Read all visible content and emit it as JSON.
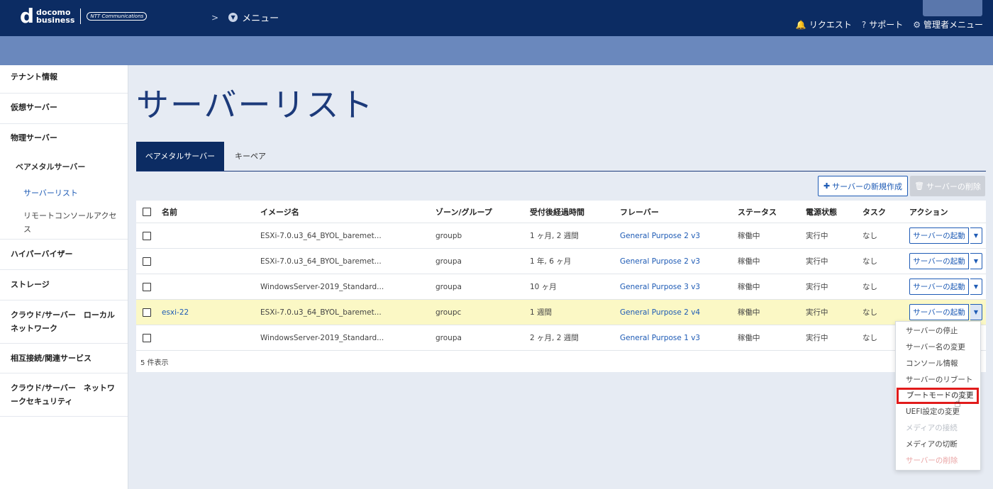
{
  "header": {
    "logo_d": "d",
    "logo_line1": "docomo",
    "logo_line2": "business",
    "logo_ntt": "NTT Communications",
    "breadcrumb_chevron": ">",
    "menu_label": "メニュー",
    "nav": [
      {
        "icon": "bell-icon",
        "label": "リクエスト"
      },
      {
        "icon": "help-icon",
        "label": "サポート"
      },
      {
        "icon": "gear-icon",
        "label": "管理者メニュー"
      }
    ]
  },
  "sidebar": {
    "items": [
      {
        "label": "テナント情報"
      },
      {
        "label": "仮想サーバー"
      },
      {
        "label": "物理サーバー"
      },
      {
        "label": "ベアメタルサーバー"
      },
      {
        "label": "サーバーリスト"
      },
      {
        "label": "リモートコンソールアクセス"
      },
      {
        "label": "ハイパーバイザー"
      },
      {
        "label": "ストレージ"
      },
      {
        "label": "クラウド/サーバー　ローカルネットワーク"
      },
      {
        "label": "相互接続/関連サービス"
      },
      {
        "label": "クラウド/サーバー　ネットワークセキュリティ"
      }
    ]
  },
  "main": {
    "title": "サーバーリスト",
    "tabs": [
      {
        "label": "ベアメタルサーバー",
        "active": true
      },
      {
        "label": "キーペア",
        "active": false
      }
    ],
    "create_button": "サーバーの新規作成",
    "delete_button": "サーバーの削除",
    "table": {
      "columns": [
        "名前",
        "イメージ名",
        "ゾーン/グループ",
        "受付後経過時間",
        "フレーバー",
        "ステータス",
        "電源状態",
        "タスク",
        "アクション"
      ],
      "rows": [
        {
          "name": "",
          "image": "ESXi-7.0.u3_64_BYOL_baremet...",
          "zone": "groupb",
          "elapsed": "1 ヶ月, 2 週間",
          "flavor": "General Purpose 2 v3",
          "status": "稼働中",
          "power": "実行中",
          "task": "なし",
          "action": "サーバーの起動"
        },
        {
          "name": "",
          "image": "ESXi-7.0.u3_64_BYOL_baremet...",
          "zone": "groupa",
          "elapsed": "1 年, 6 ヶ月",
          "flavor": "General Purpose 2 v3",
          "status": "稼働中",
          "power": "実行中",
          "task": "なし",
          "action": "サーバーの起動"
        },
        {
          "name": "",
          "image": "WindowsServer-2019_Standard...",
          "zone": "groupa",
          "elapsed": "10 ヶ月",
          "flavor": "General Purpose 3 v3",
          "status": "稼働中",
          "power": "実行中",
          "task": "なし",
          "action": "サーバーの起動"
        },
        {
          "name": "esxi-22",
          "image": "ESXi-7.0.u3_64_BYOL_baremet...",
          "zone": "groupc",
          "elapsed": "1 週間",
          "flavor": "General Purpose 2 v4",
          "status": "稼働中",
          "power": "実行中",
          "task": "なし",
          "action": "サーバーの起動"
        },
        {
          "name": "",
          "image": "WindowsServer-2019_Standard...",
          "zone": "groupa",
          "elapsed": "2 ヶ月, 2 週間",
          "flavor": "General Purpose 1 v3",
          "status": "稼働中",
          "power": "実行中",
          "task": "なし",
          "action": ""
        }
      ],
      "footer": "5 件表示"
    },
    "dropdown": [
      {
        "label": "サーバーの停止",
        "state": "enabled"
      },
      {
        "label": "サーバー名の変更",
        "state": "enabled"
      },
      {
        "label": "コンソール情報",
        "state": "enabled"
      },
      {
        "label": "サーバーのリブート",
        "state": "enabled"
      },
      {
        "label": "ブートモードの変更",
        "state": "highlighted"
      },
      {
        "label": "UEFI設定の変更",
        "state": "enabled"
      },
      {
        "label": "メディアの接続",
        "state": "disabled"
      },
      {
        "label": "メディアの切断",
        "state": "enabled"
      },
      {
        "label": "サーバーの削除",
        "state": "danger"
      }
    ]
  }
}
